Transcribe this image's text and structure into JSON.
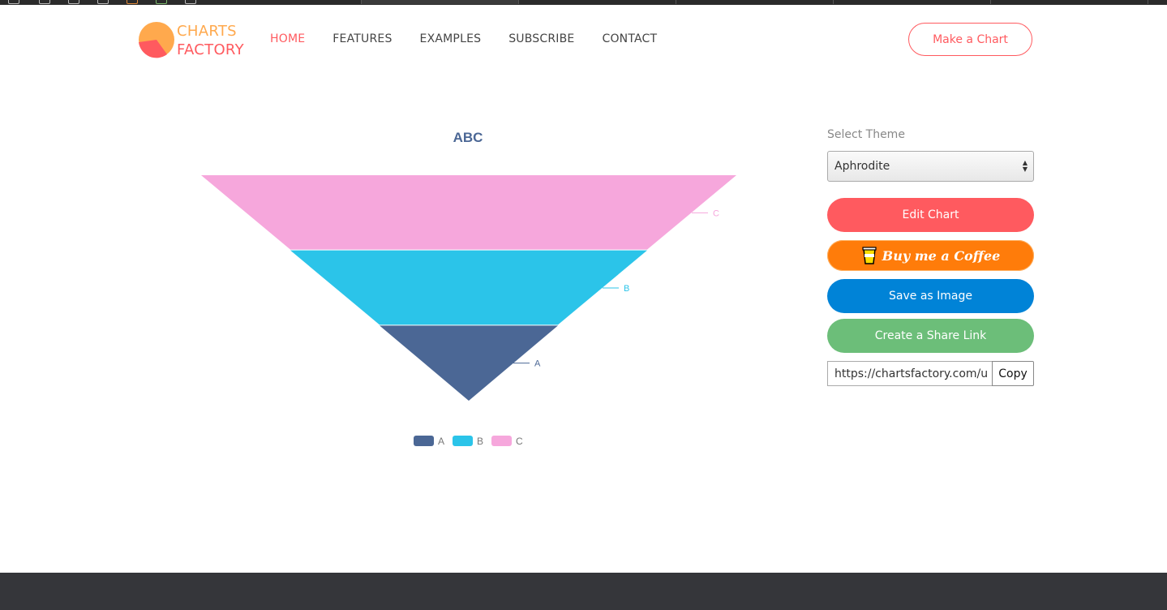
{
  "brand": {
    "line1": "CHARTS",
    "line2": "FACTORY",
    "colors": {
      "orange": "#ffa94d",
      "red": "#ff5a5f"
    }
  },
  "nav": {
    "items": [
      {
        "label": "HOME",
        "active": true
      },
      {
        "label": "FEATURES",
        "active": false
      },
      {
        "label": "EXAMPLES",
        "active": false
      },
      {
        "label": "SUBSCRIBE",
        "active": false
      },
      {
        "label": "CONTACT",
        "active": false
      }
    ]
  },
  "header": {
    "cta_label": "Make a Chart"
  },
  "chart_data": {
    "type": "funnel",
    "title": "ABC",
    "categories": [
      "A",
      "B",
      "C"
    ],
    "values": [
      1,
      2,
      3
    ],
    "colors": [
      "#4b6795",
      "#2bc4e9",
      "#f6a7dc"
    ],
    "legend_position": "bottom",
    "grid": false
  },
  "panel": {
    "theme_label": "Select Theme",
    "theme_value": "Aphrodite",
    "edit_label": "Edit Chart",
    "coffee_label": "Buy me a Coffee",
    "save_label": "Save as Image",
    "share_label": "Create a Share Link",
    "share_url": "https://chartsfactory.com/u",
    "copy_label": "Copy"
  }
}
